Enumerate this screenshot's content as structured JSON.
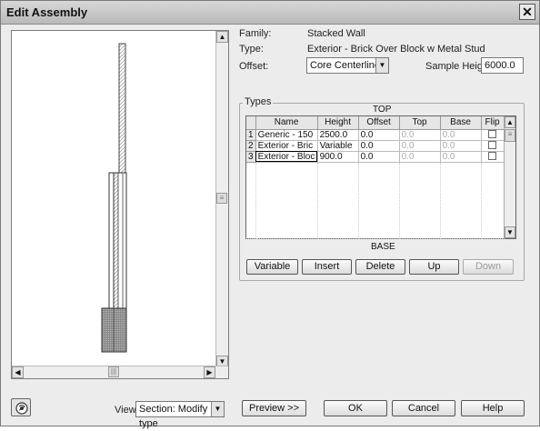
{
  "window": {
    "title": "Edit Assembly"
  },
  "info": {
    "family_label": "Family:",
    "family_value": "Stacked Wall",
    "type_label": "Type:",
    "type_value": "Exterior - Brick Over Block w Metal Stud",
    "offset_label": "Offset:",
    "offset_value": "Core Centerline",
    "sample_height_label": "Sample Height:",
    "sample_height_value": "6000.0"
  },
  "types": {
    "legend": "Types",
    "top_label": "TOP",
    "base_label": "BASE",
    "columns": [
      "Name",
      "Height",
      "Offset",
      "Top",
      "Base",
      "Flip"
    ],
    "rows": [
      {
        "num": "1",
        "name": "Generic - 150",
        "height": "2500.0",
        "offset": "0.0",
        "top": "0.0",
        "base": "0.0",
        "flip": false
      },
      {
        "num": "2",
        "name": "Exterior - Bric",
        "height": "Variable",
        "offset": "0.0",
        "top": "0.0",
        "base": "0.0",
        "flip": false
      },
      {
        "num": "3",
        "name": "Exterior - Bloc",
        "height": "900.0",
        "offset": "0.0",
        "top": "0.0",
        "base": "0.0",
        "flip": false
      }
    ],
    "buttons": {
      "variable": "Variable",
      "insert": "Insert",
      "delete": "Delete",
      "up": "Up",
      "down": "Down"
    }
  },
  "footer": {
    "view_label": "View:",
    "view_value": "Section: Modify type",
    "preview": "Preview >>",
    "ok": "OK",
    "cancel": "Cancel",
    "help": "Help"
  },
  "icons": {
    "close": "close-icon",
    "scroll_up": "arrow-up-icon",
    "scroll_down": "arrow-down-icon",
    "scroll_left": "arrow-left-icon",
    "scroll_right": "arrow-right-icon",
    "dropdown": "chevron-down-icon",
    "help_tool": "tooltip-help-icon"
  }
}
